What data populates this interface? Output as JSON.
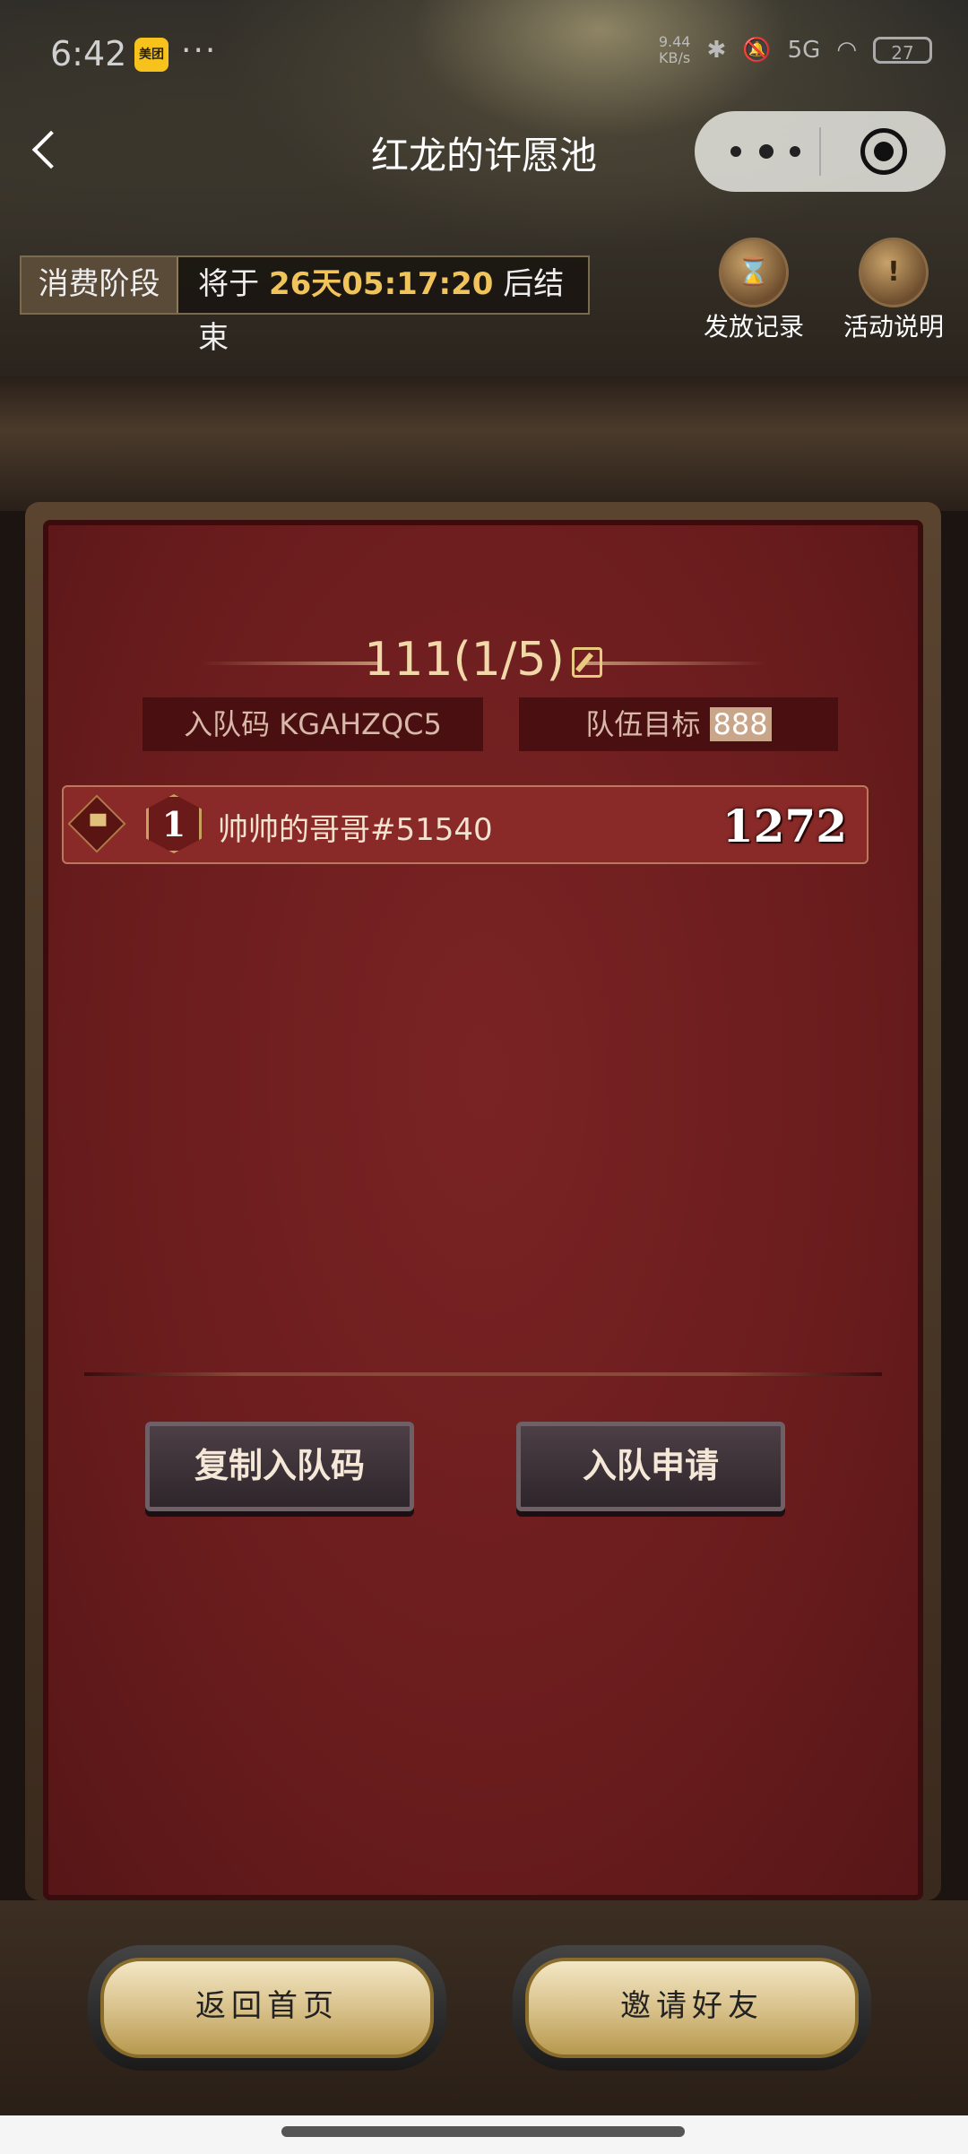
{
  "status_bar": {
    "time": "6:42",
    "app_badge": "美团",
    "more": "···",
    "net_speed": "9.44\nKB/s",
    "signal": "5G",
    "battery": "27"
  },
  "header": {
    "title": "红龙的许愿池",
    "phase_label": "消费阶段",
    "phase_prefix": "将于 ",
    "phase_countdown": "26天05:17:20",
    "phase_suffix": " 后结束",
    "record_label": "发放记录",
    "rules_label": "活动说明"
  },
  "team": {
    "name": "111(1/5)",
    "code_label": "入队码 KGAHZQC5",
    "goal_label": "队伍目标 ",
    "goal_value": "888",
    "members": [
      {
        "rank": "1",
        "name": "帅帅的哥哥#51540",
        "score": "1272"
      }
    ],
    "copy_button": "复制入队码",
    "apply_button": "入队申请"
  },
  "footer": {
    "home_button": "返回首页",
    "invite_button": "邀请好友"
  }
}
